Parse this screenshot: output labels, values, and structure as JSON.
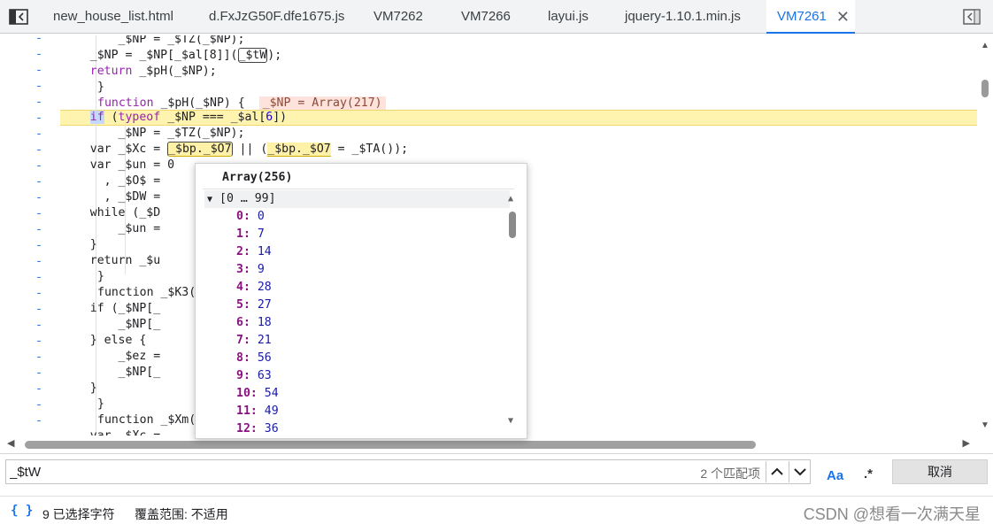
{
  "tabs": [
    {
      "label": "new_house_list.html"
    },
    {
      "label": "d.FxJzG50F.dfe1675.js"
    },
    {
      "label": "VM7262"
    },
    {
      "label": "VM7266"
    },
    {
      "label": "layui.js"
    },
    {
      "label": "jquery-1.10.1.min.js"
    },
    {
      "label": "VM7261",
      "active": true
    }
  ],
  "tab_close_glyph": "✕",
  "gutter_marker": "-",
  "code": {
    "l1": "        _$NP = _$TZ(_$NP);",
    "l2a": "    _$NP = _$NP[_$al[8]](",
    "l2b": "_$tW",
    "l2c": ");",
    "l3a": "    ",
    "l3b": "return",
    "l3c": " _$pH(_$NP);",
    "l4": "}",
    "l5a": "function",
    "l5b": " _$pH(_$NP) {  ",
    "l5c": "_$NP = Array(217)",
    "l6a": "    ",
    "l6b": "if",
    "l6c": " (",
    "l6d": "typeof",
    "l6e": " _$NP === _$al[",
    "l6f": "6",
    "l6g": "])",
    "l7": "        _$NP = _$TZ(_$NP);",
    "l8a": "    var _$Xc = ",
    "l8b": "_$bp._$O7",
    "l8c": " || (",
    "l8d": "_$bp._$O7",
    "l8e": " = _$TA());",
    "l9": "    var _$un = 0",
    "l10": "      , _$O$ =",
    "l11": "      , _$DW =",
    "l12": "    while (_$D",
    "l13": "        _$un =",
    "l14": "    }",
    "l15": "    return _$u",
    "l16": "}",
    "l17": "function _$K3(",
    "l18": "    if (_$NP[_",
    "l19": "        _$NP[_",
    "l20": "    } else {",
    "l21": "        _$ez =",
    "l22": "        _$NP[_",
    "l23": "    }",
    "l24": "}",
    "l25": "function _$Xm(",
    "l26": "    var _$Xc ="
  },
  "popover": {
    "title": "Array(256)",
    "range_label": "[0 … 99]",
    "items": [
      {
        "k": "0",
        "v": "0"
      },
      {
        "k": "1",
        "v": "7"
      },
      {
        "k": "2",
        "v": "14"
      },
      {
        "k": "3",
        "v": "9"
      },
      {
        "k": "4",
        "v": "28"
      },
      {
        "k": "5",
        "v": "27"
      },
      {
        "k": "6",
        "v": "18"
      },
      {
        "k": "7",
        "v": "21"
      },
      {
        "k": "8",
        "v": "56"
      },
      {
        "k": "9",
        "v": "63"
      },
      {
        "k": "10",
        "v": "54"
      },
      {
        "k": "11",
        "v": "49"
      },
      {
        "k": "12",
        "v": "36"
      }
    ]
  },
  "search": {
    "value": "_$tW",
    "match_count": "2 个匹配项",
    "match_case_label": "Aa",
    "regex_label": ".*",
    "cancel_label": "取消"
  },
  "status": {
    "braces": "{ }",
    "selected": "9 已选择字符",
    "coverage": "覆盖范围: 不适用",
    "watermark": "CSDN @想看一次满天星"
  },
  "colors": {
    "accent": "#1a73e8",
    "highlight_line": "#fff3b0",
    "inline_value_bg": "#fde3dc"
  }
}
